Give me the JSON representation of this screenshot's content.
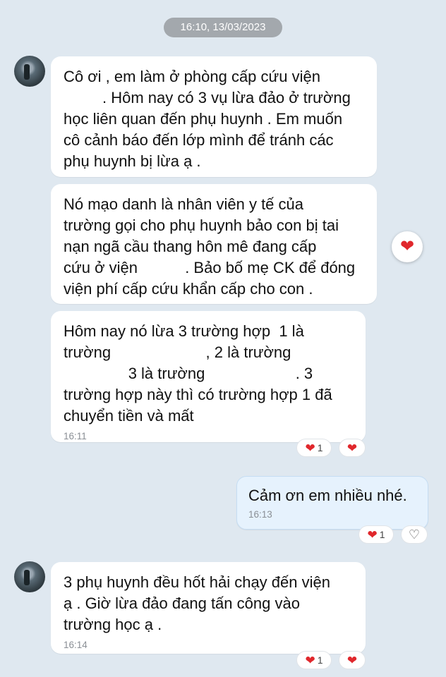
{
  "date_separator": "16:10, 13/03/2023",
  "messages": [
    {
      "text": "Cô ơi , em làm ở phòng cấp cứu viện\n         . Hôm nay có 3 vụ lừa đảo ở trường\nhọc liên quan đến phụ huynh . Em muốn\ncô cảnh báo đến lớp mình để tránh các\nphụ huynh bị lừa ạ ."
    },
    {
      "text": "Nó mạo danh là nhân viên y tế của\ntrường gọi cho phụ huynh bảo con bị tai\nnạn ngã cầu thang hôn mê đang cấp\ncứu ở viện           . Bảo bố mẹ CK để đóng\nviện phí cấp cứu khẩn cấp cho con ."
    },
    {
      "text": "Hôm nay nó lừa 3 trường hợp  1 là\ntrường                      , 2 là trường\n               3 là trường                     . 3\ntrường hợp này thì có trường hợp 1 đã\nchuyển tiền và mất",
      "time": "16:11",
      "reaction_count": "1"
    },
    {
      "text": "Cảm ơn em nhiều nhé.",
      "time": "16:13",
      "reaction_count": "1"
    },
    {
      "text": "3 phụ huynh đều hốt hải chạy đến viện\nạ . Giờ lừa đảo đang tấn công vào\ntrường học ạ .",
      "time": "16:14",
      "reaction_count": "1"
    }
  ],
  "icons": {
    "heart": "❤",
    "heart_outline": "♡"
  },
  "colors": {
    "background": "#dfe8f0",
    "my_bubble": "#e6f2fd",
    "heart": "#e0272c"
  }
}
